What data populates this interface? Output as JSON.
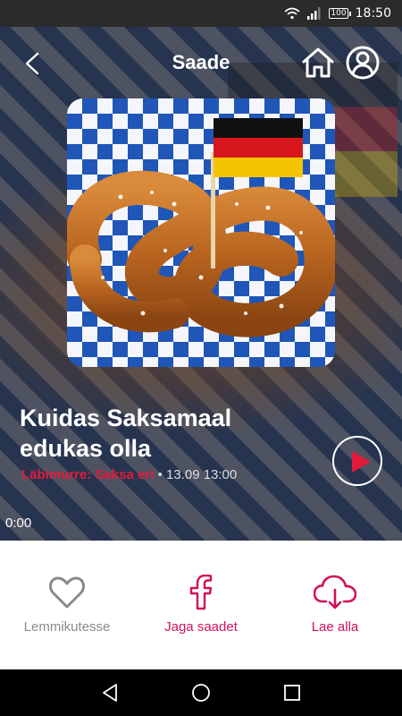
{
  "status_bar": {
    "battery": "100",
    "time": "18:50",
    "icons": [
      "wifi-icon",
      "signal-icon",
      "battery-icon"
    ]
  },
  "header": {
    "title": "Saade",
    "icons": [
      "back-icon",
      "home-icon",
      "profile-icon"
    ]
  },
  "episode": {
    "title": "Kuidas Saksamaal edukas olla",
    "show": "Läbimurre: Saksa eri",
    "separator": " • ",
    "datetime": "13.09 13:00",
    "position": "0:00"
  },
  "actions": [
    {
      "label": "Lemmikutesse",
      "icon": "heart-icon"
    },
    {
      "label": "Jaga saadet",
      "icon": "facebook-icon"
    },
    {
      "label": "Lae alla",
      "icon": "cloud-download-icon"
    }
  ],
  "colors": {
    "accent": "#e31b3a",
    "pink": "#d0115a",
    "grey": "#8a8a8a"
  },
  "nav_bar": {
    "icons": [
      "nav-back-icon",
      "nav-home-icon",
      "nav-recents-icon"
    ]
  }
}
